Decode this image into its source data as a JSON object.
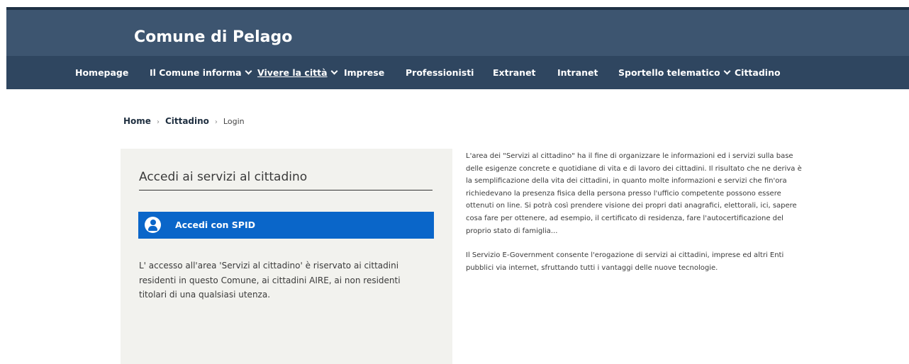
{
  "header": {
    "site_title": "Comune di Pelago"
  },
  "nav": {
    "items": [
      {
        "label": "Homepage",
        "has_dropdown": false
      },
      {
        "label": "Il Comune informa",
        "has_dropdown": true
      },
      {
        "label": "Vivere la città",
        "has_dropdown": true,
        "active": true
      },
      {
        "label": "Imprese",
        "has_dropdown": false
      },
      {
        "label": "Professionisti",
        "has_dropdown": false
      },
      {
        "label": "Extranet",
        "has_dropdown": false
      },
      {
        "label": "Intranet",
        "has_dropdown": false
      },
      {
        "label": "Sportello telematico",
        "has_dropdown": true
      },
      {
        "label": "Cittadino",
        "has_dropdown": false
      }
    ]
  },
  "breadcrumb": {
    "home": "Home",
    "section": "Cittadino",
    "current": "Login",
    "separator": "›"
  },
  "login": {
    "title": "Accedi ai servizi al cittadino",
    "spid_label": "Accedi con SPID",
    "note": "L' accesso all'area 'Servizi al cittadino' è riservato ai cittadini residenti in questo Comune, ai cittadini AIRE, ai non residenti titolari di una qualsiasi utenza."
  },
  "info": {
    "paragraph1": "L'area dei \"Servizi al cittadino\" ha il fine di organizzare le informazioni ed i servizi sulla base delle esigenze concrete e quotidiane di vita e di lavoro dei cittadini. Il risultato che ne deriva è la semplificazione della vita dei cittadini, in quanto molte informazioni e servizi che fin'ora richiedevano la presenza fisica della persona presso l'ufficio competente possono essere ottenuti on line. Si potrà così prendere visione dei propri dati anagrafici, elettorali, ici, sapere cosa fare per ottenere, ad esempio, il certificato di residenza, fare l'autocertificazione del proprio stato di famiglia...",
    "paragraph2": "Il Servizio E-Government consente l'erogazione di servizi ai cittadini, imprese ed altri Enti pubblici via internet, sfruttando tutti i vantaggi delle nuove tecnologie."
  },
  "colors": {
    "header_bg": "#3d5570",
    "nav_bg": "#2f4660",
    "spid_blue": "#0a66c9",
    "panel_bg": "#f2f2ee"
  },
  "icons": {
    "nav_dropdown": "chevron-down-icon",
    "spid": "user-circle-icon"
  }
}
